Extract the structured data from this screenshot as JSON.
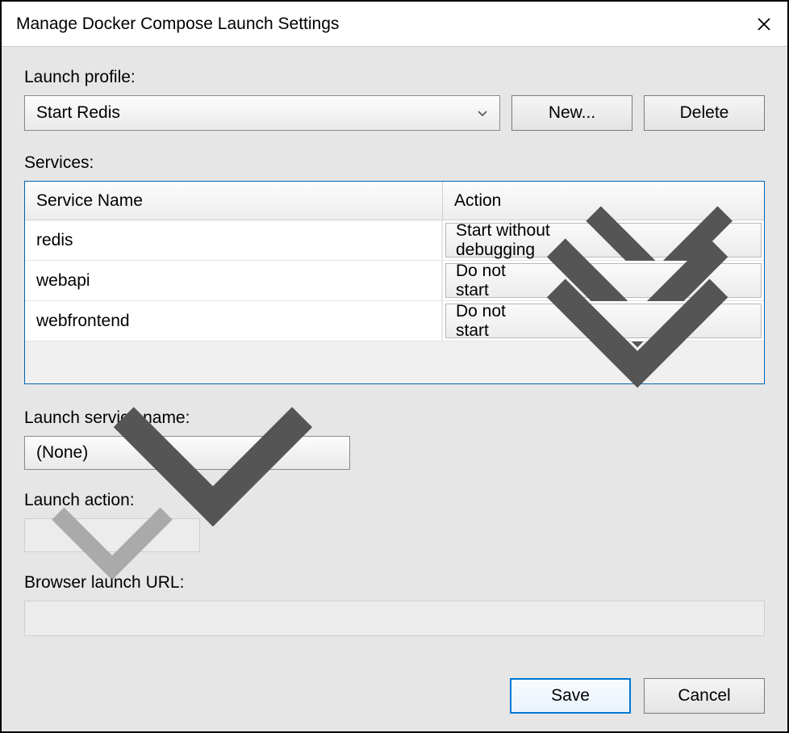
{
  "title": "Manage Docker Compose Launch Settings",
  "launchProfile": {
    "label": "Launch profile:",
    "selected": "Start Redis",
    "newButton": "New...",
    "deleteButton": "Delete"
  },
  "services": {
    "label": "Services:",
    "headers": {
      "name": "Service Name",
      "action": "Action"
    },
    "rows": [
      {
        "name": "redis",
        "action": "Start without debugging"
      },
      {
        "name": "webapi",
        "action": "Do not start"
      },
      {
        "name": "webfrontend",
        "action": "Do not start"
      }
    ]
  },
  "launchServiceName": {
    "label": "Launch service name:",
    "selected": "(None)"
  },
  "launchAction": {
    "label": "Launch action:",
    "selected": ""
  },
  "browserUrl": {
    "label": "Browser launch URL:",
    "value": ""
  },
  "footer": {
    "save": "Save",
    "cancel": "Cancel"
  }
}
